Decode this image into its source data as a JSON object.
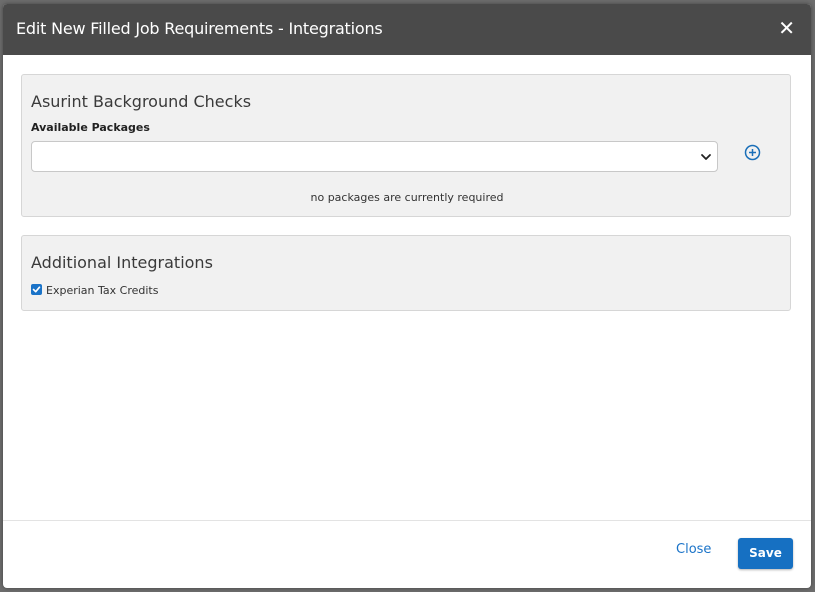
{
  "dialog": {
    "title": "Edit New Filled Job Requirements - Integrations",
    "close_icon": "close-icon"
  },
  "asurint": {
    "title": "Asurint Background Checks",
    "packages_label": "Available Packages",
    "packages_selected": "",
    "add_icon": "plus-circle-icon",
    "empty_note": "no packages are currently required"
  },
  "additional": {
    "title": "Additional Integrations",
    "items": [
      {
        "label": "Experian Tax Credits",
        "checked": true
      }
    ]
  },
  "footer": {
    "close_label": "Close",
    "save_label": "Save"
  },
  "colors": {
    "header_bg": "#4a4a4a",
    "accent": "#1670c2",
    "panel_bg": "#f1f1f1"
  }
}
